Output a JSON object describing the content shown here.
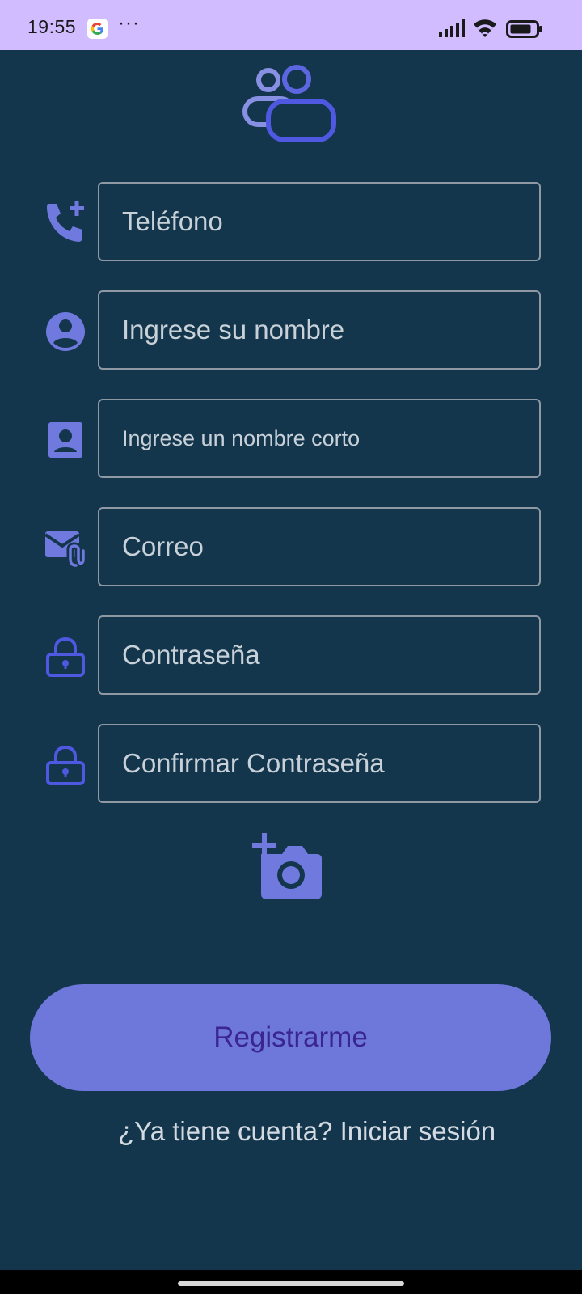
{
  "status_bar": {
    "time": "19:55",
    "notification_icons": [
      "google-icon",
      "more-dots-icon"
    ],
    "more_glyph": "···",
    "right_icons": [
      "signal-icon",
      "wifi-icon",
      "battery-icon"
    ]
  },
  "colors": {
    "background": "#13364d",
    "status_bar": "#d0bcff",
    "accent": "#6e78db",
    "icon": "#7079de",
    "button_text": "#3b2590",
    "field_border": "#8f99a3"
  },
  "form": {
    "phone": {
      "placeholder": "Teléfono",
      "icon": "add-call-icon"
    },
    "name": {
      "placeholder": "Ingrese su nombre",
      "icon": "account-circle-icon"
    },
    "short_name": {
      "placeholder": "Ingrese un nombre corto",
      "icon": "contact-card-icon"
    },
    "email": {
      "placeholder": "Correo",
      "icon": "mail-attachment-icon"
    },
    "password": {
      "placeholder": "Contraseña",
      "icon": "lock-icon"
    },
    "confirm_password": {
      "placeholder": "Confirmar Contraseña",
      "icon": "lock-icon"
    },
    "photo_icon": "add-photo-camera-icon"
  },
  "actions": {
    "register_label": "Registrarme",
    "login_link": "¿Ya tiene cuenta? Iniciar sesión"
  }
}
